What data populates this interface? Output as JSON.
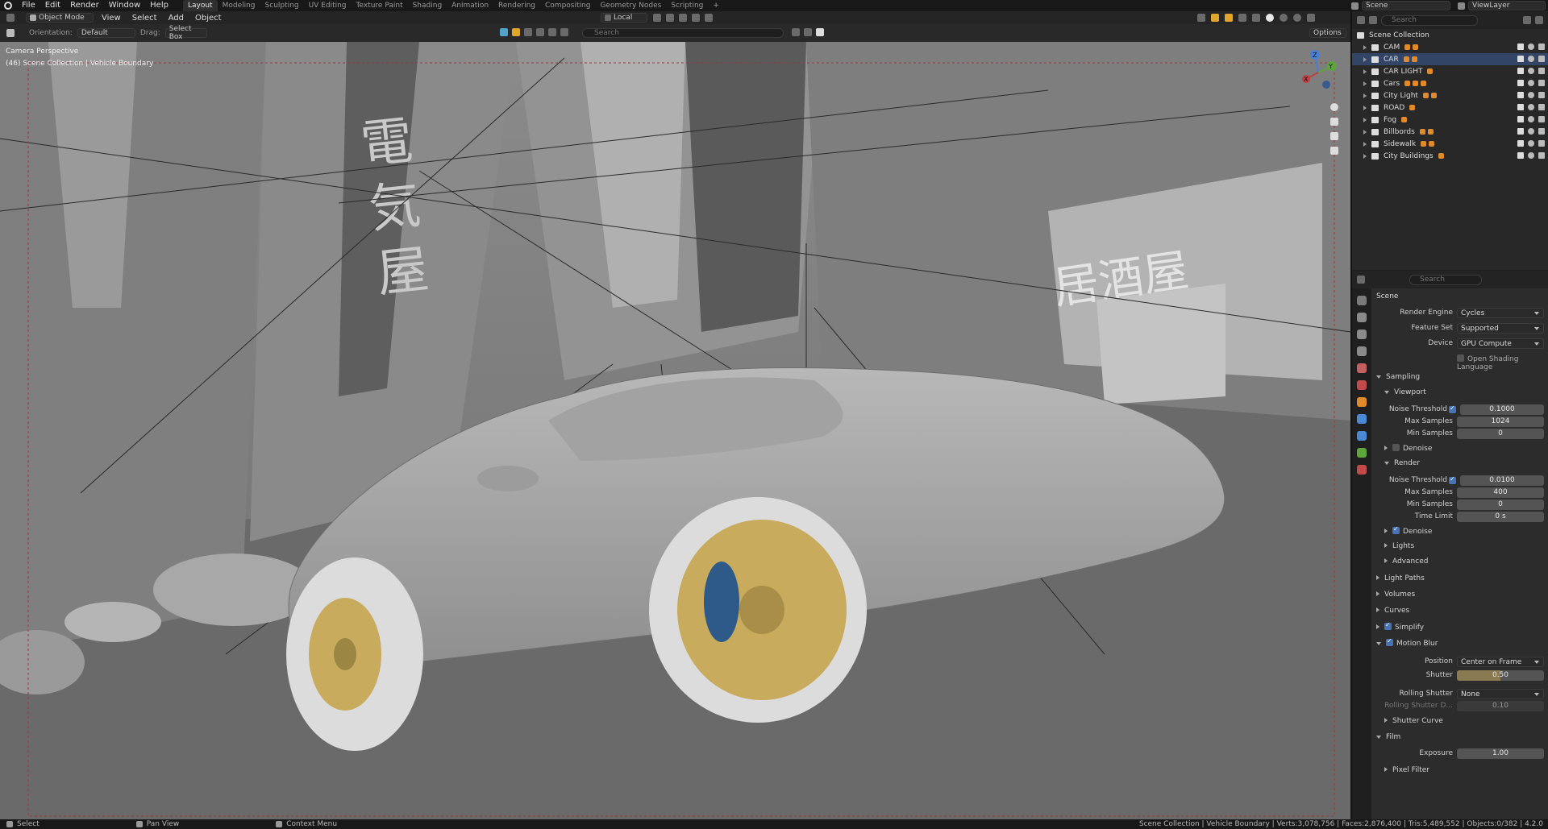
{
  "topbar": {
    "menus": [
      "File",
      "Edit",
      "Render",
      "Window",
      "Help"
    ],
    "workspaces": [
      "Layout",
      "Modeling",
      "Sculpting",
      "UV Editing",
      "Texture Paint",
      "Shading",
      "Animation",
      "Rendering",
      "Compositing",
      "Geometry Nodes",
      "Scripting"
    ],
    "active_workspace": "Layout",
    "add_tab": "+",
    "scene": "Scene",
    "view_layer": "ViewLayer"
  },
  "viewport_header": {
    "mode": "Object Mode",
    "menus": [
      "View",
      "Select",
      "Add",
      "Object"
    ],
    "transform_space": "Local",
    "options": "Options"
  },
  "tool_settings": {
    "orientation_label": "Orientation:",
    "orientation": "Default",
    "drag_label": "Drag:",
    "drag": "Select Box",
    "search_placeholder": "Search"
  },
  "viewport": {
    "view_name": "Camera Perspective",
    "collection_info": "(46) Scene Collection | Vehicle Boundary",
    "gizmo": {
      "x": "X",
      "y": "Y",
      "z": "Z"
    }
  },
  "outliner": {
    "search_placeholder": "Search",
    "root": "Scene Collection",
    "items": [
      {
        "name": "CAM",
        "selected": false
      },
      {
        "name": "CAR",
        "selected": true
      },
      {
        "name": "CAR LIGHT",
        "selected": false
      },
      {
        "name": "Cars",
        "selected": false
      },
      {
        "name": "City Light",
        "selected": false
      },
      {
        "name": "ROAD",
        "selected": false
      },
      {
        "name": "Fog",
        "selected": false
      },
      {
        "name": "Billbords",
        "selected": false
      },
      {
        "name": "Sidewalk",
        "selected": false
      },
      {
        "name": "City Buildings",
        "selected": false
      }
    ]
  },
  "properties": {
    "search_placeholder": "Search",
    "context": "Scene",
    "render_engine_label": "Render Engine",
    "render_engine": "Cycles",
    "feature_set_label": "Feature Set",
    "feature_set": "Supported",
    "device_label": "Device",
    "device": "GPU Compute",
    "osl_label": "Open Shading Language",
    "sampling": "Sampling",
    "viewport": "Viewport",
    "noise_threshold_label": "Noise Threshold",
    "vp_noise_threshold": "0.1000",
    "max_samples_label": "Max Samples",
    "vp_max_samples": "1024",
    "min_samples_label": "Min Samples",
    "vp_min_samples": "0",
    "denoise": "Denoise",
    "render": "Render",
    "r_noise_threshold": "0.0100",
    "r_max_samples": "400",
    "r_min_samples": "0",
    "time_limit_label": "Time Limit",
    "r_time_limit": "0 s",
    "lights": "Lights",
    "advanced": "Advanced",
    "light_paths": "Light Paths",
    "volumes": "Volumes",
    "curves": "Curves",
    "simplify": "Simplify",
    "motion_blur": "Motion Blur",
    "position_label": "Position",
    "position": "Center on Frame",
    "shutter_label": "Shutter",
    "shutter": "0.50",
    "shutter_fraction": 0.5,
    "rolling_shutter_label": "Rolling Shutter",
    "rolling_shutter": "None",
    "rolling_shutter_d_label": "Rolling Shutter D...",
    "rolling_shutter_d": "0.10",
    "shutter_curve": "Shutter Curve",
    "film": "Film",
    "exposure_label": "Exposure",
    "exposure": "1.00",
    "pixel_filter": "Pixel Filter"
  },
  "statusbar": {
    "select": "Select",
    "pan_view": "Pan View",
    "context_menu": "Context Menu",
    "stats": "Scene Collection | Vehicle Boundary | Verts:3,078,756 | Faces:2,876,400 | Tris:5,489,552 | Objects:0/382 | 4.2.0"
  },
  "colors": {
    "accent": "#4772b3",
    "object_orange": "#e08a2c",
    "rim_gold": "#c8ab5c",
    "brake_blue": "#2e5a8a"
  }
}
